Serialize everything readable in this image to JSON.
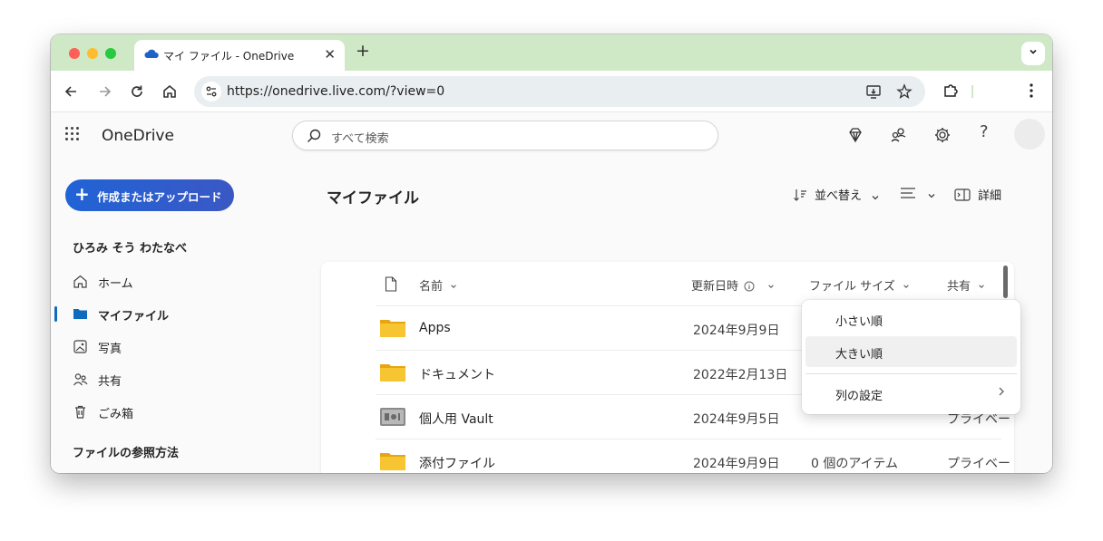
{
  "browser": {
    "tab_title": "マイ ファイル - OneDrive",
    "new_tab": "+",
    "tab_close": "✕",
    "url": "https://onedrive.live.com/?view=0"
  },
  "header": {
    "brand": "OneDrive",
    "search_placeholder": "すべて検索",
    "help": "?"
  },
  "sidebar": {
    "create_label": "作成またはアップロード",
    "create_plus": "+",
    "user_name": "ひろみ そう わたなべ",
    "items": [
      {
        "label": "ホーム",
        "icon": "home-icon"
      },
      {
        "label": "マイファイル",
        "icon": "folder-icon",
        "active": true
      },
      {
        "label": "写真",
        "icon": "photo-icon"
      },
      {
        "label": "共有",
        "icon": "people-icon"
      },
      {
        "label": "ごみ箱",
        "icon": "trash-icon"
      }
    ],
    "section_title": "ファイルの参照方法"
  },
  "main": {
    "title": "マイファイル",
    "sort_label": "並べ替え",
    "details_label": "詳細",
    "columns": {
      "name": "名前",
      "modified": "更新日時",
      "size": "ファイル サイズ",
      "sharing": "共有"
    },
    "rows": [
      {
        "name": "Apps",
        "modified": "2024年9月9日",
        "size": "",
        "sharing": "",
        "icon": "folder-icon"
      },
      {
        "name": "ドキュメント",
        "modified": "2022年2月13日",
        "size": "",
        "sharing": "",
        "icon": "folder-icon"
      },
      {
        "name": "個人用 Vault",
        "modified": "2024年9月5日",
        "size": "",
        "sharing": "プライベー",
        "icon": "vault-icon"
      },
      {
        "name": "添付ファイル",
        "modified": "2024年9月9日",
        "size": "0 個のアイテム",
        "sharing": "プライベー",
        "icon": "folder-icon"
      }
    ]
  },
  "sort_menu": {
    "items": [
      "小さい順",
      "大きい順"
    ],
    "highlighted": "大きい順",
    "column_settings": "列の設定"
  },
  "colors": {
    "accent": "#0f6cbd",
    "create_button": "#2163d6",
    "tab_strip": "#cfe8c5",
    "folder": "#f5c232"
  }
}
